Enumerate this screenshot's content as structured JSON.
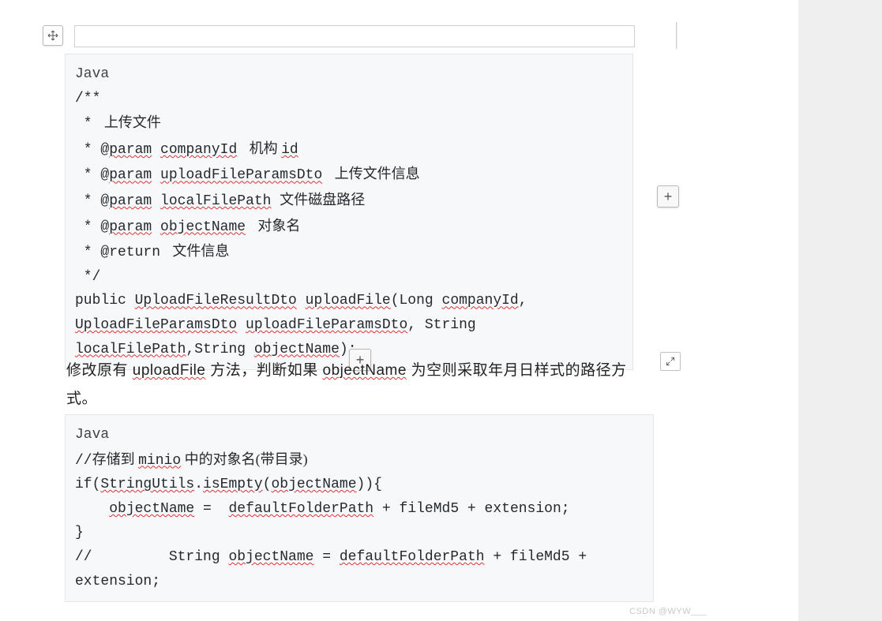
{
  "codeBlock1": {
    "lang": "Java",
    "lines": [
      {
        "segments": [
          {
            "text": "/**"
          }
        ]
      },
      {
        "segments": [
          {
            "text": " * "
          },
          {
            "text": " 上传文件",
            "cls": "cjk"
          }
        ]
      },
      {
        "segments": [
          {
            "text": " * @"
          },
          {
            "text": "param",
            "cls": "wavy"
          },
          {
            "text": " "
          },
          {
            "text": "companyId",
            "cls": "wavy"
          },
          {
            "text": " "
          },
          {
            "text": " 机构 ",
            "cls": "cjk"
          },
          {
            "text": "id",
            "cls": "wavy"
          }
        ]
      },
      {
        "segments": [
          {
            "text": " * @"
          },
          {
            "text": "param",
            "cls": "wavy"
          },
          {
            "text": " "
          },
          {
            "text": "uploadFileParamsDto",
            "cls": "wavy"
          },
          {
            "text": " "
          },
          {
            "text": " 上传文件信息",
            "cls": "cjk"
          }
        ]
      },
      {
        "segments": [
          {
            "text": " * @"
          },
          {
            "text": "param",
            "cls": "wavy"
          },
          {
            "text": " "
          },
          {
            "text": "localFilePath",
            "cls": "wavy"
          },
          {
            "text": " "
          },
          {
            "text": "文件磁盘路径",
            "cls": "cjk"
          }
        ]
      },
      {
        "segments": [
          {
            "text": " * @"
          },
          {
            "text": "param",
            "cls": "wavy"
          },
          {
            "text": " "
          },
          {
            "text": "objectName",
            "cls": "wavy"
          },
          {
            "text": " "
          },
          {
            "text": " 对象名",
            "cls": "cjk"
          }
        ]
      },
      {
        "segments": [
          {
            "text": " * @return "
          },
          {
            "text": " 文件信息",
            "cls": "cjk"
          }
        ]
      },
      {
        "segments": [
          {
            "text": " */"
          }
        ]
      },
      {
        "segments": [
          {
            "text": "public "
          },
          {
            "text": "UploadFileResultDto",
            "cls": "wavy"
          },
          {
            "text": " "
          },
          {
            "text": "uploadFile",
            "cls": "wavy"
          },
          {
            "text": "(Long "
          },
          {
            "text": "companyId",
            "cls": "wavy"
          },
          {
            "text": ", "
          }
        ]
      },
      {
        "segments": [
          {
            "text": "UploadFileParamsDto",
            "cls": "wavy"
          },
          {
            "text": " "
          },
          {
            "text": "uploadFileParamsDto",
            "cls": "wavy"
          },
          {
            "text": ", String "
          }
        ]
      },
      {
        "segments": [
          {
            "text": "localFilePath",
            "cls": "wavy"
          },
          {
            "text": ",String "
          },
          {
            "text": "objectName",
            "cls": "wavy"
          },
          {
            "text": ");"
          }
        ]
      }
    ]
  },
  "description": {
    "segments": [
      {
        "text": "修改原有 "
      },
      {
        "text": "uploadFile",
        "cls": "wavy"
      },
      {
        "text": " 方法，判断如果 "
      },
      {
        "text": "objectName",
        "cls": "wavy"
      },
      {
        "text": " 为空则采取年月日样式的路径方式。"
      }
    ]
  },
  "codeBlock2": {
    "lang": "Java",
    "lines": [
      {
        "segments": [
          {
            "text": "//"
          },
          {
            "text": "存储到 ",
            "cls": "cjk"
          },
          {
            "text": "minio",
            "cls": "wavy"
          },
          {
            "text": " 中的对象名(带目录)",
            "cls": "cjk"
          }
        ]
      },
      {
        "segments": [
          {
            "text": "if("
          },
          {
            "text": "StringUtils",
            "cls": "wavy"
          },
          {
            "text": "."
          },
          {
            "text": "isEmpty",
            "cls": "wavy"
          },
          {
            "text": "("
          },
          {
            "text": "objectName",
            "cls": "wavy"
          },
          {
            "text": ")){"
          }
        ]
      },
      {
        "segments": [
          {
            "text": "    "
          },
          {
            "text": "objectName",
            "cls": "wavy"
          },
          {
            "text": " =  "
          },
          {
            "text": "defaultFolderPath",
            "cls": "wavy"
          },
          {
            "text": " + fileMd5 + extension;"
          }
        ]
      },
      {
        "segments": [
          {
            "text": "}"
          }
        ]
      },
      {
        "segments": [
          {
            "text": "//         String "
          },
          {
            "text": "objectName",
            "cls": "wavy"
          },
          {
            "text": " = "
          },
          {
            "text": "defaultFolderPath",
            "cls": "wavy"
          },
          {
            "text": " + fileMd5 + "
          }
        ]
      },
      {
        "segments": [
          {
            "text": "extension;"
          }
        ]
      }
    ]
  },
  "watermark": "CSDN @WYW___",
  "plus": "+"
}
